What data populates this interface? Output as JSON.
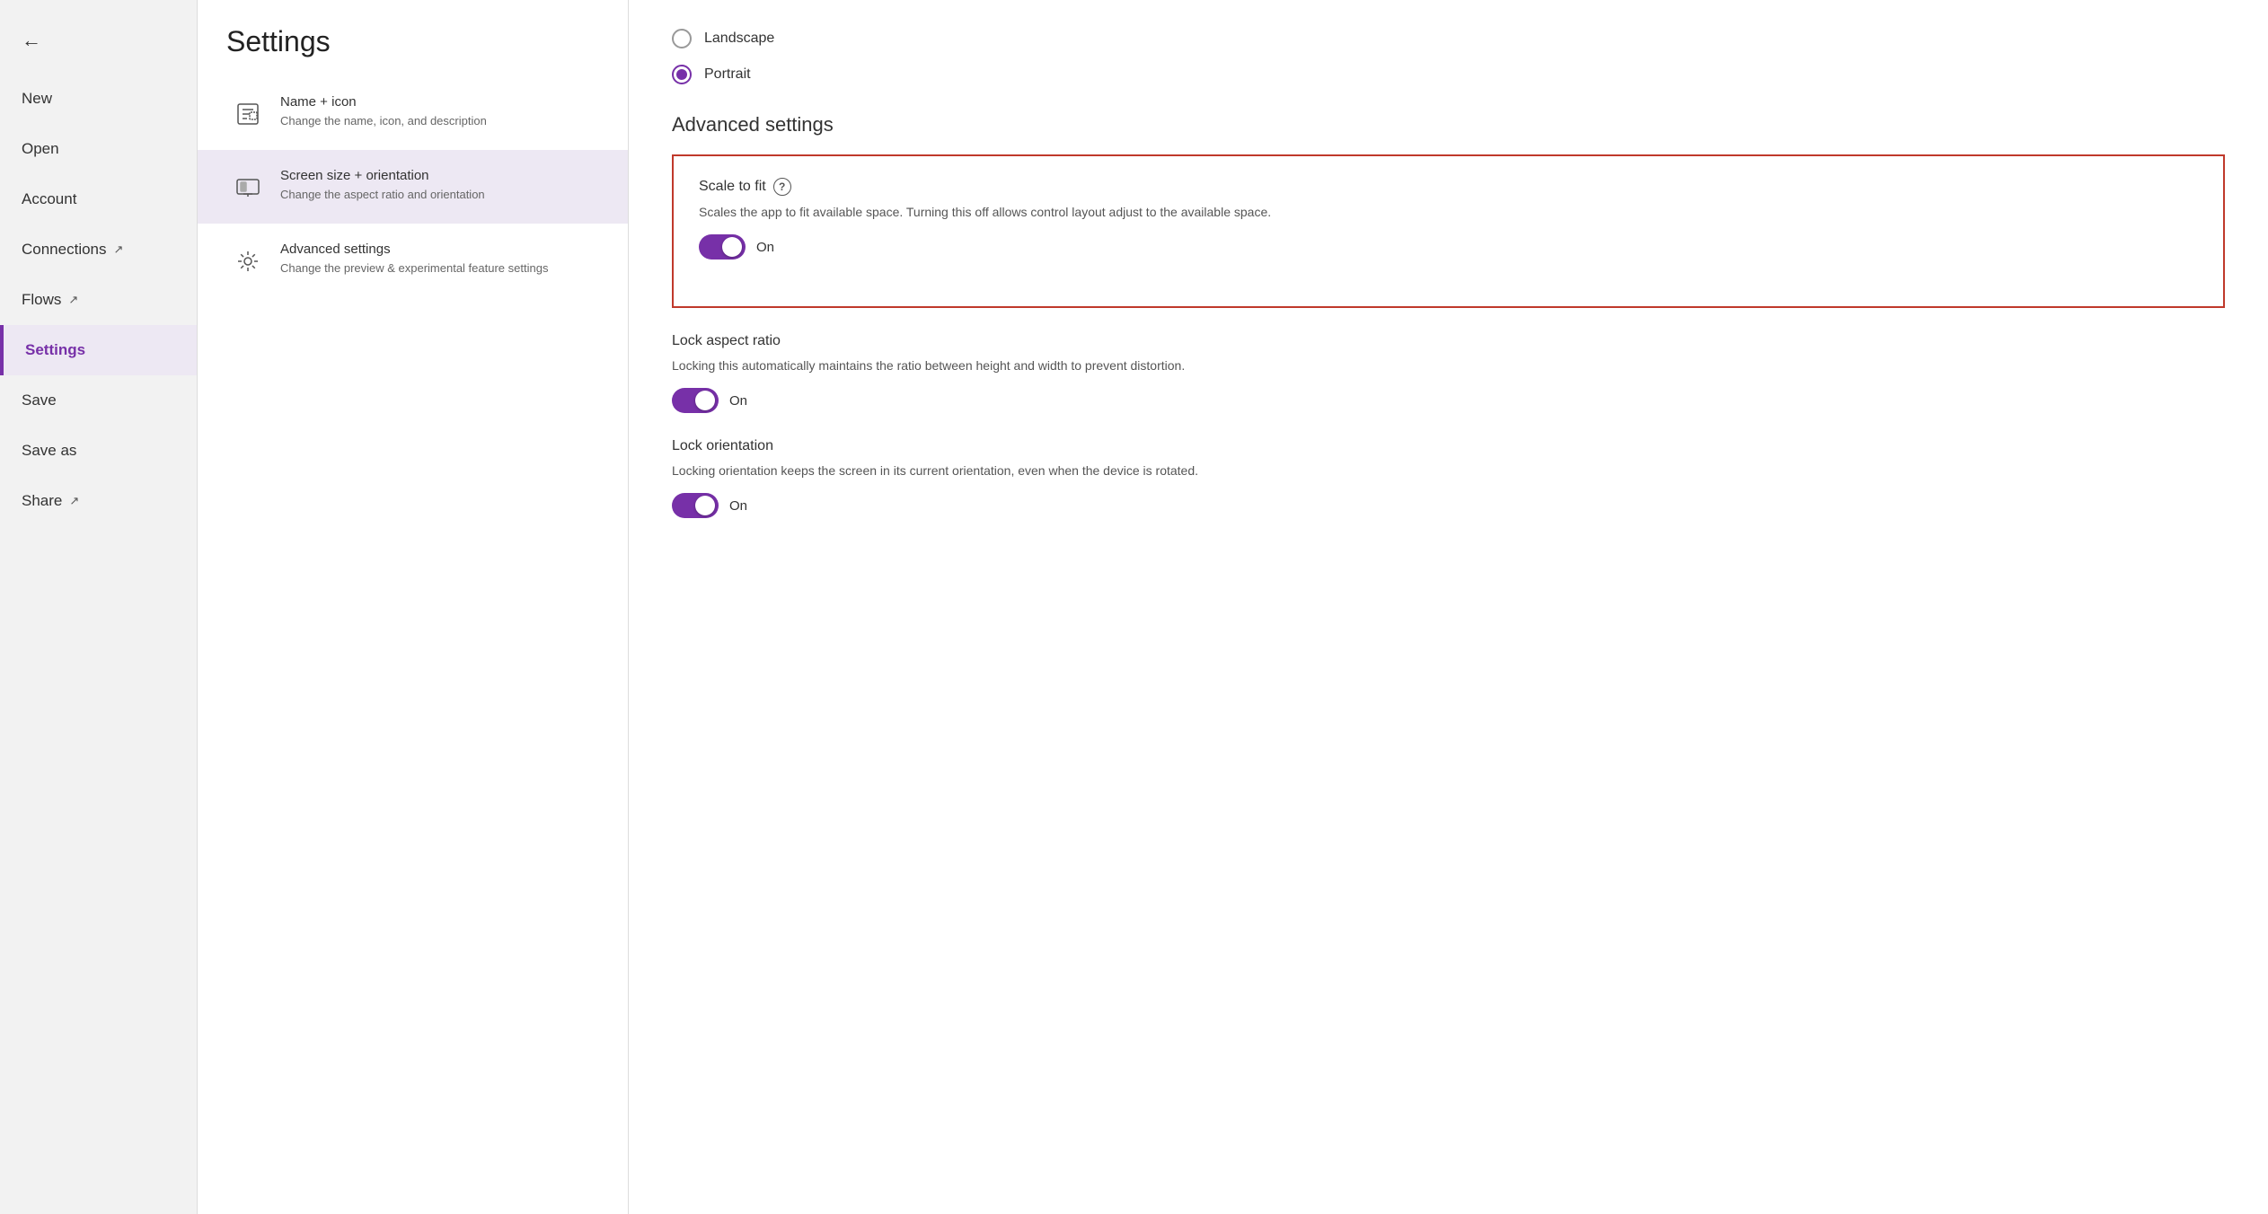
{
  "sidebar": {
    "back_label": "←",
    "items": [
      {
        "id": "new",
        "label": "New",
        "active": false,
        "external": false
      },
      {
        "id": "open",
        "label": "Open",
        "active": false,
        "external": false
      },
      {
        "id": "account",
        "label": "Account",
        "active": false,
        "external": false
      },
      {
        "id": "connections",
        "label": "Connections",
        "active": false,
        "external": true
      },
      {
        "id": "flows",
        "label": "Flows",
        "active": false,
        "external": true
      },
      {
        "id": "settings",
        "label": "Settings",
        "active": true,
        "external": false
      },
      {
        "id": "save",
        "label": "Save",
        "active": false,
        "external": false
      },
      {
        "id": "save-as",
        "label": "Save as",
        "active": false,
        "external": false
      },
      {
        "id": "share",
        "label": "Share",
        "active": false,
        "external": true
      }
    ]
  },
  "page": {
    "title": "Settings"
  },
  "settings_menu": {
    "items": [
      {
        "id": "name-icon",
        "title": "Name + icon",
        "description": "Change the name, icon, and description",
        "selected": false
      },
      {
        "id": "screen-size",
        "title": "Screen size + orientation",
        "description": "Change the aspect ratio and orientation",
        "selected": true
      },
      {
        "id": "advanced-settings",
        "title": "Advanced settings",
        "description": "Change the preview & experimental feature settings",
        "selected": false
      }
    ]
  },
  "right_panel": {
    "orientation": {
      "landscape_label": "Landscape",
      "portrait_label": "Portrait",
      "landscape_selected": false,
      "portrait_selected": true
    },
    "advanced_settings_title": "Advanced settings",
    "scale_to_fit": {
      "title": "Scale to fit",
      "description": "Scales the app to fit available space. Turning this off allows control layout adjust to the available space.",
      "toggle_state": "On",
      "toggle_on": true
    },
    "lock_aspect_ratio": {
      "title": "Lock aspect ratio",
      "description": "Locking this automatically maintains the ratio between height and width to prevent distortion.",
      "toggle_state": "On",
      "toggle_on": true
    },
    "lock_orientation": {
      "title": "Lock orientation",
      "description": "Locking orientation keeps the screen in its current orientation, even when the device is rotated.",
      "toggle_state": "On",
      "toggle_on": true
    }
  }
}
